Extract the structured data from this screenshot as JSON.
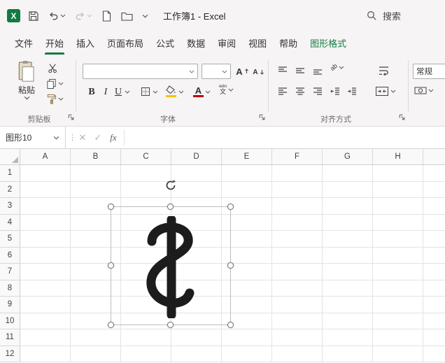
{
  "titlebar": {
    "title": "工作簿1 - Excel",
    "search_label": "搜索"
  },
  "tabs": [
    {
      "label": "文件"
    },
    {
      "label": "开始",
      "active": true
    },
    {
      "label": "插入"
    },
    {
      "label": "页面布局"
    },
    {
      "label": "公式"
    },
    {
      "label": "数据"
    },
    {
      "label": "审阅"
    },
    {
      "label": "视图"
    },
    {
      "label": "帮助"
    },
    {
      "label": "图形格式",
      "contextual": true
    }
  ],
  "ribbon": {
    "clipboard": {
      "group_label": "剪贴板",
      "paste_label": "粘贴"
    },
    "font": {
      "group_label": "字体",
      "font_name_value": "",
      "font_size_value": "",
      "bold": "B",
      "italic": "I",
      "underline": "U",
      "grow_font": "A",
      "shrink_font": "A",
      "font_color_letter": "A",
      "phonetic_pinyin": "wén",
      "phonetic_char": "文"
    },
    "alignment": {
      "group_label": "对齐方式",
      "orientation_glyph": "ab"
    },
    "number": {
      "format_value": "常规"
    }
  },
  "formula_bar": {
    "name_box_value": "图形10",
    "cancel_glyph": "✕",
    "enter_glyph": "✓",
    "fx_glyph": "fx",
    "formula_value": ""
  },
  "sheet": {
    "columns": [
      "A",
      "B",
      "C",
      "D",
      "E",
      "F",
      "G",
      "H"
    ],
    "rows": [
      "1",
      "2",
      "3",
      "4",
      "5",
      "6",
      "7",
      "8",
      "9",
      "10",
      "11",
      "12"
    ],
    "selected_shape_name": "图形10"
  },
  "icons": {
    "logo_letter": "X"
  },
  "colors": {
    "excel_green": "#107C41",
    "shape_stroke": "#1c1c1c",
    "fill_color_bar": "#FFC000",
    "font_color_bar": "#C00000"
  }
}
